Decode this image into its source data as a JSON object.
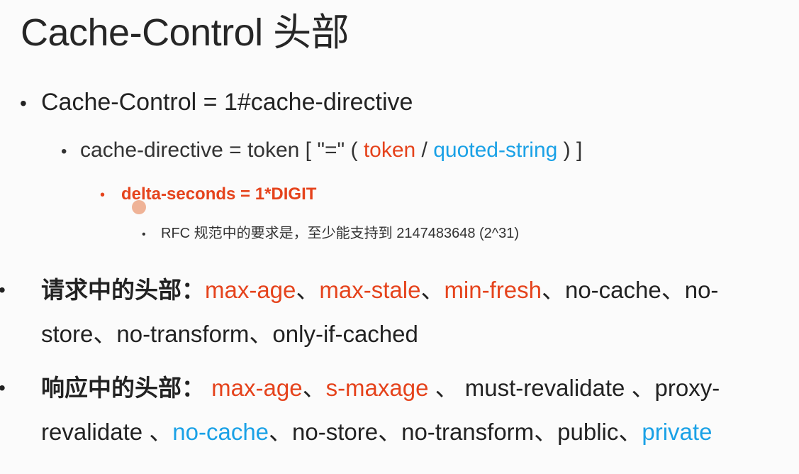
{
  "title": "Cache-Control 头部",
  "bullet": "•",
  "line1": {
    "text": "Cache-Control = 1#cache-directive"
  },
  "line2": {
    "prefix": "cache-directive = token [ \"=\" ( ",
    "token": "token",
    "sep": " / ",
    "quoted": "quoted-string",
    "suffix": " ) ]"
  },
  "line3": {
    "text": "delta-seconds = 1*DIGIT"
  },
  "line4": {
    "text": "RFC 规范中的要求是，至少能支持到 2147483648 (2^31)"
  },
  "request": {
    "label": "请求中的头部：",
    "items": [
      {
        "text": "max-age",
        "color": "red"
      },
      {
        "text": "、",
        "color": "plain"
      },
      {
        "text": "max-stale",
        "color": "red"
      },
      {
        "text": "、",
        "color": "plain"
      },
      {
        "text": "min-fresh",
        "color": "red"
      },
      {
        "text": "、no-cache、no-store、no-transform、only-if-cached",
        "color": "plain"
      }
    ]
  },
  "response": {
    "label": "响应中的头部：",
    "items": [
      {
        "text": " max-age",
        "color": "red"
      },
      {
        "text": "、",
        "color": "plain"
      },
      {
        "text": "s-maxage",
        "color": "red"
      },
      {
        "text": " 、 must-revalidate 、proxy-revalidate 、",
        "color": "plain"
      },
      {
        "text": "no-cache",
        "color": "blue"
      },
      {
        "text": "、no-store、no-transform、public、",
        "color": "plain"
      },
      {
        "text": "private",
        "color": "blue"
      }
    ]
  },
  "colors": {
    "red": "#e5431c",
    "blue": "#1aa1e6",
    "text": "#222222"
  }
}
